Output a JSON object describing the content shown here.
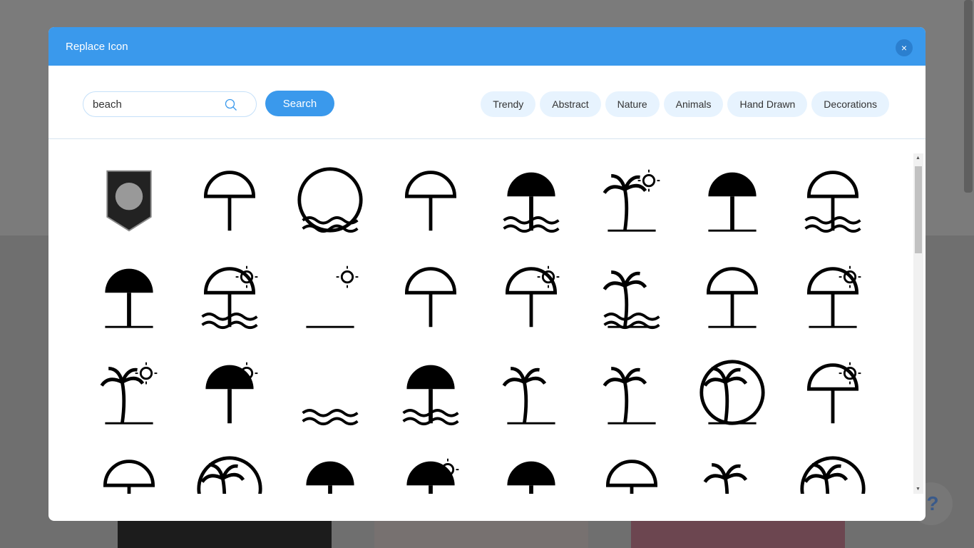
{
  "dialog": {
    "title": "Replace Icon",
    "close_label": "×"
  },
  "search": {
    "value": "beach",
    "button_label": "Search"
  },
  "categories": [
    "Trendy",
    "Abstract",
    "Nature",
    "Animals",
    "Hand Drawn",
    "Decorations"
  ],
  "help_label": "?",
  "colors": {
    "accent": "#3a99ec",
    "chip": "#e7f3fe"
  },
  "icons": [
    "palm-badge-icon",
    "striped-umbrella-icon",
    "beach-circle-icon",
    "umbrella-ball-icon",
    "umbrella-waves-icon",
    "palm-sun-umbrella-icon",
    "umbrella-hearts-icon",
    "umbrella-sea-icon",
    "tilted-umbrella-island-icon",
    "umbrella-sun-waves-icon",
    "sun-surfboard-icon",
    "umbrella-lounger-icon",
    "sun-lounger-umbrella-icon",
    "palm-leaf-waves-icon",
    "lounger-umbrella-icon",
    "umbrella-sun-line-icon",
    "palm-sun-icon",
    "sun-umbrella-lounger-icon",
    "wave-landscape-icon",
    "umbrella-shore-icon",
    "palm-chair-icon",
    "palm-shore-icon",
    "island-circle-icon",
    "plane-umbrella-icon",
    "small-umbrella-icon",
    "island-badge-icon",
    "umbrella-icon",
    "sun-sea-umbrella-icon",
    "solid-umbrella-icon",
    "outline-umbrella-icon",
    "palms-hearts-icon",
    "palm-ring-icon"
  ]
}
